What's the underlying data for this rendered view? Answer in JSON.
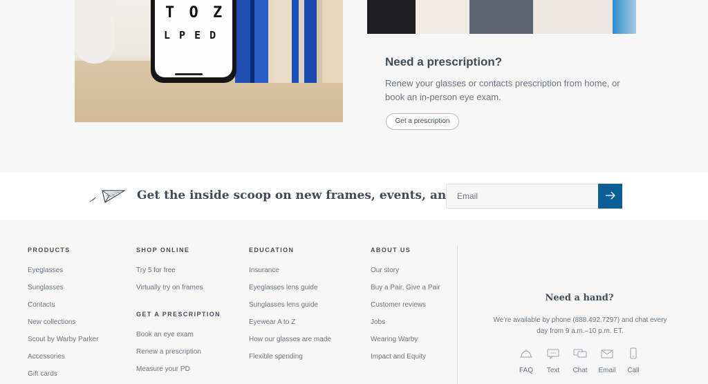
{
  "promo": {
    "phone_chart_line1": "T O Z",
    "phone_chart_line2": "L P E D",
    "title": "Need a prescription?",
    "body": "Renew your glasses or contacts prescription from home, or book an in-person eye exam.",
    "button_label": "Get a prescription"
  },
  "newsletter": {
    "heading": "Get the inside scoop on new frames, events, and more",
    "email_placeholder": "Email",
    "submit_icon": "arrow-right-icon",
    "accent_color": "#0c5f96"
  },
  "footer": {
    "products": {
      "heading": "PRODUCTS",
      "links": [
        "Eyeglasses",
        "Sunglasses",
        "Contacts",
        "New collections",
        "Scout by Warby Parker",
        "Accessories",
        "Gift cards"
      ]
    },
    "shop_online": {
      "heading": "SHOP ONLINE",
      "links": [
        "Try 5 for free",
        "Virtually try on frames"
      ]
    },
    "get_prescription": {
      "heading": "GET A PRESCRIPTION",
      "links": [
        "Book an eye exam",
        "Renew a prescription",
        "Measure your PD"
      ]
    },
    "education": {
      "heading": "EDUCATION",
      "links": [
        "Insurance",
        "Eyeglasses lens guide",
        "Sunglasses lens guide",
        "Eyewear A to Z",
        "How our glasses are made",
        "Flexible spending"
      ]
    },
    "about_us": {
      "heading": "ABOUT US",
      "links": [
        "Our story",
        "Buy a Pair, Give a Pair",
        "Customer reviews",
        "Jobs",
        "Wearing Warby",
        "Impact and Equity"
      ]
    },
    "help": {
      "title": "Need a hand?",
      "body": "We’re available by phone (888.492.7297) and chat every day from 9 a.m.–10 p.m. ET.",
      "contacts": [
        {
          "label": "FAQ",
          "icon": "bell-icon"
        },
        {
          "label": "Text",
          "icon": "message-icon"
        },
        {
          "label": "Chat",
          "icon": "chat-icon"
        },
        {
          "label": "Email",
          "icon": "envelope-icon"
        },
        {
          "label": "Call",
          "icon": "phone-icon"
        }
      ]
    }
  }
}
